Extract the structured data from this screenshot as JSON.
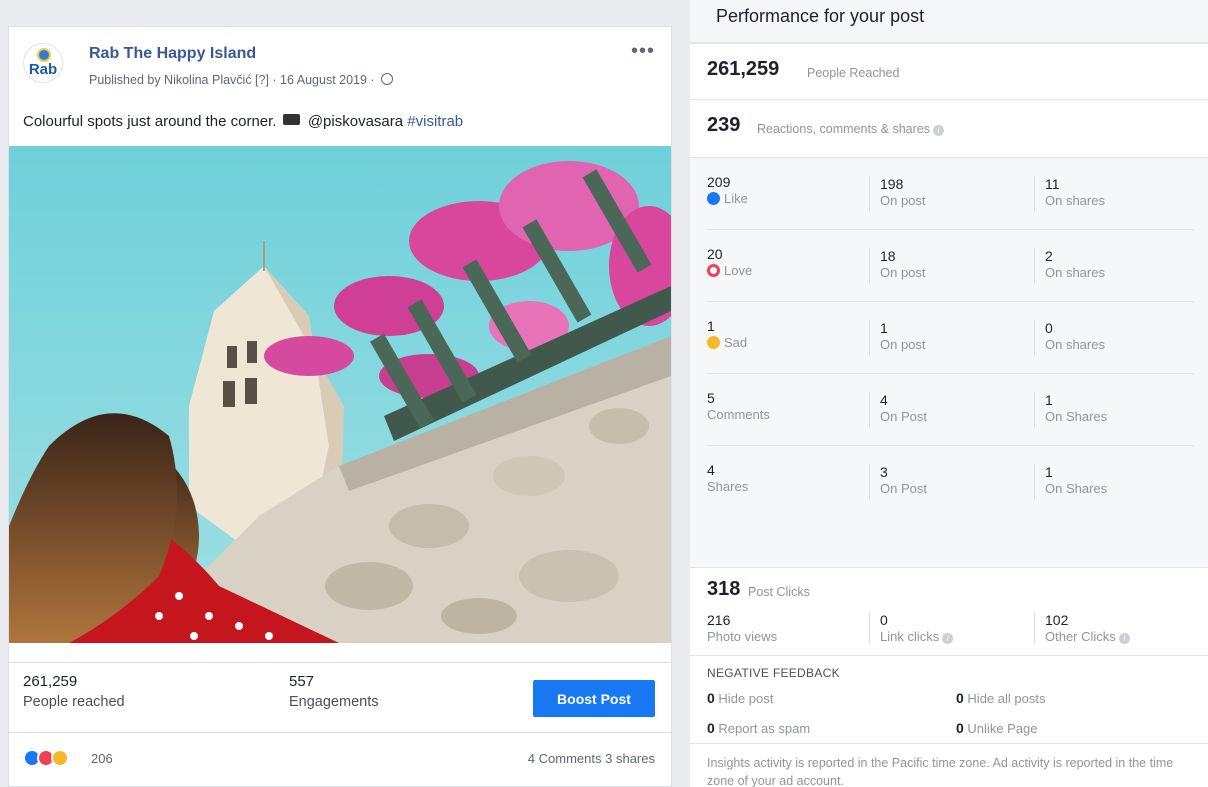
{
  "post": {
    "page_name": "Rab The Happy Island",
    "avatar_text": "Rab",
    "published_text": "Published by Nikolina Plavčić [?] · 16 August 2019 ·",
    "more_label": "•••",
    "caption_text": "Colourful spots just around the corner.",
    "caption_mention": "@piskovasara",
    "caption_hashtag": "#visitrab",
    "stats": {
      "reached_value": "261,259",
      "reached_label": "People reached",
      "engagements_value": "557",
      "engagements_label": "Engagements"
    },
    "boost_label": "Boost Post",
    "reaction_count": "206",
    "comments_label": "4 Comments",
    "shares_label": "3 shares"
  },
  "performance": {
    "title": "Performance for your post",
    "people_reached_value": "261,259",
    "people_reached_label": "People Reached",
    "reactions_value": "239",
    "reactions_label": "Reactions, comments & shares",
    "breakdown": [
      {
        "total": "209",
        "label": "Like",
        "icon": "like-icon",
        "post": "198",
        "post_label": "On post",
        "shares": "11",
        "shares_label": "On shares"
      },
      {
        "total": "20",
        "label": "Love",
        "icon": "love-icon",
        "post": "18",
        "post_label": "On post",
        "shares": "2",
        "shares_label": "On shares"
      },
      {
        "total": "1",
        "label": "Sad",
        "icon": "sad-icon",
        "post": "1",
        "post_label": "On post",
        "shares": "0",
        "shares_label": "On shares"
      },
      {
        "total": "5",
        "label": "Comments",
        "post": "4",
        "post_label": "On Post",
        "shares": "1",
        "shares_label": "On Shares"
      },
      {
        "total": "4",
        "label": "Shares",
        "post": "3",
        "post_label": "On Post",
        "shares": "1",
        "shares_label": "On Shares"
      }
    ],
    "clicks": {
      "value": "318",
      "label": "Post Clicks",
      "photo_views": "216",
      "photo_views_label": "Photo views",
      "link_clicks": "0",
      "link_clicks_label": "Link clicks",
      "other_clicks": "102",
      "other_clicks_label": "Other Clicks"
    },
    "negative": {
      "title": "NEGATIVE FEEDBACK",
      "hide_post_value": "0",
      "hide_post_label": "Hide post",
      "hide_all_value": "0",
      "hide_all_label": "Hide all posts",
      "spam_value": "0",
      "spam_label": "Report as spam",
      "unlike_value": "0",
      "unlike_label": "Unlike Page"
    },
    "footnote": "Insights activity is reported in the Pacific time zone. Ad activity is reported in the time zone of your ad account."
  },
  "colors": {
    "accent": "#1877f2",
    "link": "#385898",
    "love": "#f33e58",
    "sad": "#f7b928"
  }
}
